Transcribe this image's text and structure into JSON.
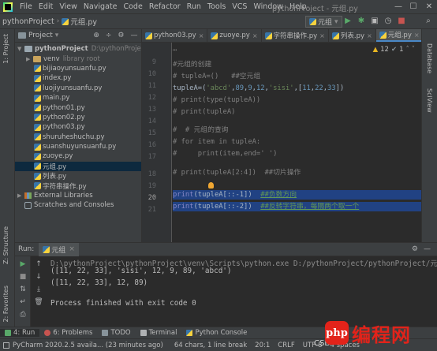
{
  "menubar": {
    "items": [
      "File",
      "Edit",
      "View",
      "Navigate",
      "Code",
      "Refactor",
      "Run",
      "Tools",
      "VCS",
      "Window",
      "Help"
    ],
    "window_title": "pythonProject - 元组.py",
    "minimize": "—",
    "maximize": "☐",
    "close": "✕"
  },
  "navbar": {
    "project": "pythonProject",
    "file": "元组.py",
    "run_config": "元组"
  },
  "left_strip": {
    "project_tab": "1: Project",
    "structure_tab": "Z: Structure",
    "favorites_tab": "2: Favorites"
  },
  "right_strip": {
    "database_tab": "Database",
    "sciview_tab": "SciView"
  },
  "project_panel": {
    "title": "Project",
    "root_name": "pythonProject",
    "root_path": "D:\\pythonProject\\",
    "venv_name": "venv",
    "venv_label": "library root",
    "files": [
      "bijiaoyunsuanfu.py",
      "index.py",
      "luojiyunsuanfu.py",
      "main.py",
      "python01.py",
      "python02.py",
      "python03.py",
      "shuruheshuchu.py",
      "suanshuyunsuanfu.py",
      "zuoye.py",
      "元组.py",
      "列表.py",
      "字符串操作.py"
    ],
    "selected_index": 10,
    "external_libraries": "External Libraries",
    "scratches": "Scratches and Consoles"
  },
  "editor": {
    "tabs": [
      "python03.py",
      "zuoye.py",
      "字符串操作.py",
      "列表.py",
      "元组.py"
    ],
    "active_tab": 4,
    "inspection": {
      "warnings": "12",
      "weak": "1"
    },
    "gutter_lines": [
      "9",
      "10",
      "11",
      "12",
      "13",
      "14",
      "15",
      "16",
      "17",
      "18",
      "19",
      "20",
      "21"
    ],
    "current_line": "20",
    "code": {
      "l0": "#元组的创建",
      "l1": "# tupleA=()   ##空元组",
      "l2a": "tupleA=(",
      "l2b": "'abcd'",
      "l2c": ",",
      "l2d": "89",
      "l2e": ",",
      "l2f": "9",
      "l2g": ",",
      "l2h": "12",
      "l2i": ",",
      "l2j": "'sisi'",
      "l2k": ",[",
      "l2l": "11",
      "l2m": ",",
      "l2n": "22",
      "l2o": ",",
      "l2p": "33",
      "l2q": "])",
      "l3": "# print(type(tupleA))",
      "l4": "# print(tupleA)",
      "l5": "#  # 元组的查询",
      "l6": "# for item in tupleA:",
      "l7": "#     print(item,end=' ')",
      "l8": "# print(tupleA[2:4])  ##切片操作",
      "l9a": "print",
      "l9b": "(tupleA[::-1])  ",
      "l9c": "##负数方向",
      "l10a": "print",
      "l10b": "(tupleA[::-2])  ",
      "l10c": "##反转字符串，每隔两个取一个"
    }
  },
  "run_panel": {
    "label": "Run:",
    "tab": "元组",
    "console": [
      "D:\\pythonProject\\pythonProject\\venv\\Scripts\\python.exe D:/pythonProject/pythonProject/元组.py",
      "([11, 22, 33], 'sisi', 12, 9, 89, 'abcd')",
      "([11, 22, 33], 12, 89)",
      "",
      "Process finished with exit code 0"
    ]
  },
  "bottom_tabs": [
    "4: Run",
    "6: Problems",
    "TODO",
    "Terminal",
    "Python Console"
  ],
  "statusbar": {
    "message": "PyCharm 2020.2.5 availa... (23 minutes ago)",
    "chars": "64 chars, 1 line break",
    "position": "20:1",
    "line_sep": "CRLF",
    "encoding": "UTF-8",
    "indent": "4 spaces"
  },
  "watermark": {
    "logo": "php",
    "text": "编程网",
    "csd": "CSD"
  },
  "colors": {
    "selection": "#214283",
    "accent": "#4a88c7",
    "brand_red": "#e2231a"
  }
}
